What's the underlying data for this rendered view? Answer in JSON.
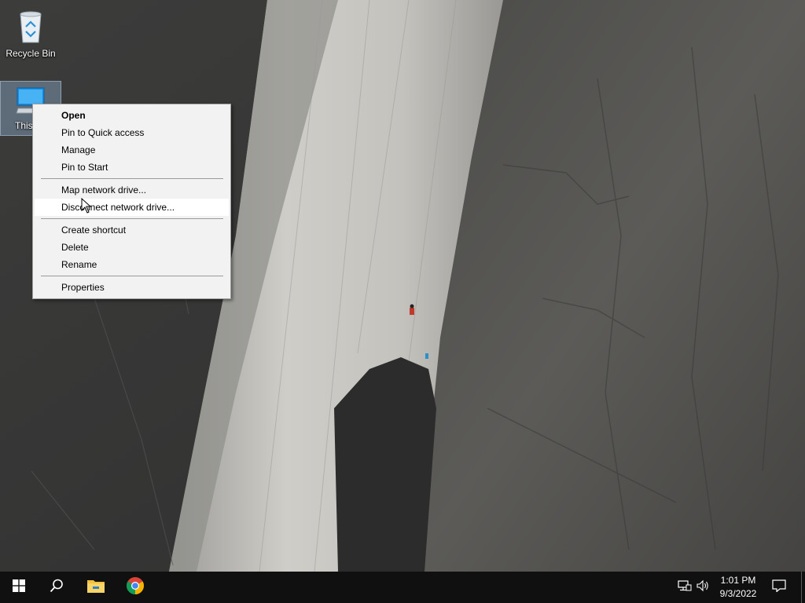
{
  "desktop": {
    "icons": [
      {
        "id": "recycle-bin",
        "label": "Recycle Bin"
      },
      {
        "id": "this-pc",
        "label": "This PC"
      }
    ]
  },
  "context_menu": {
    "groups": [
      {
        "items": [
          {
            "label": "Open",
            "bold": true
          },
          {
            "label": "Pin to Quick access"
          },
          {
            "label": "Manage"
          },
          {
            "label": "Pin to Start"
          }
        ]
      },
      {
        "items": [
          {
            "label": "Map network drive..."
          },
          {
            "label": "Disconnect network drive...",
            "hover": true
          }
        ]
      },
      {
        "items": [
          {
            "label": "Create shortcut"
          },
          {
            "label": "Delete"
          },
          {
            "label": "Rename"
          }
        ]
      },
      {
        "items": [
          {
            "label": "Properties"
          }
        ]
      }
    ]
  },
  "taskbar": {
    "start_icon": "windows-logo-icon",
    "search_icon": "search-icon",
    "pinned": [
      {
        "name": "file-explorer-icon"
      },
      {
        "name": "chrome-icon"
      }
    ],
    "tray": {
      "network_icon": "network-icon",
      "volume_icon": "volume-icon",
      "time": "1:01 PM",
      "date": "9/3/2022",
      "notification_icon": "notification-icon"
    }
  },
  "colors": {
    "menu_background": "#f2f2f2",
    "menu_hover": "#ffffff",
    "taskbar": "#101010",
    "explorer_yellow": "#f3c13a",
    "chrome_red": "#db4437",
    "chrome_green": "#0f9d58",
    "chrome_yellow": "#f4b400",
    "chrome_blue": "#4285f4"
  }
}
